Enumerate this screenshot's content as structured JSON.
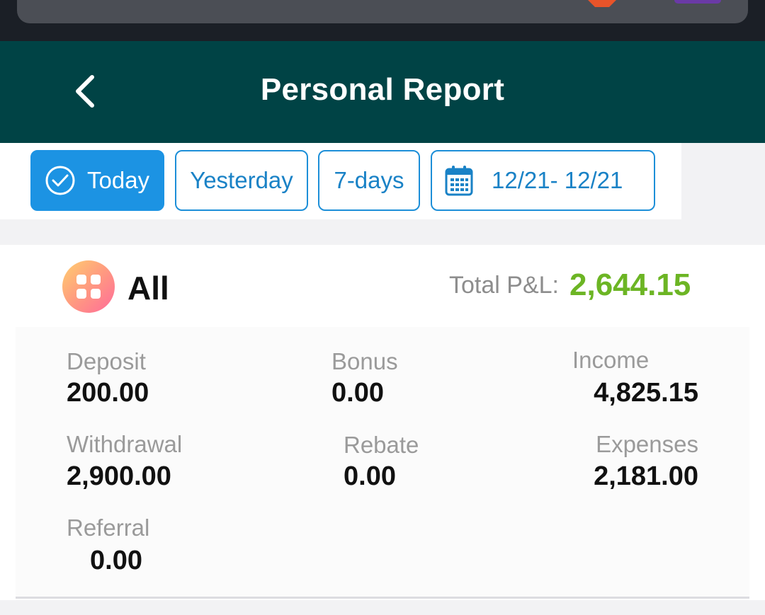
{
  "header": {
    "title": "Personal Report"
  },
  "filters": {
    "today": "Today",
    "yesterday": "Yesterday",
    "seven_days": "7-days",
    "date_range": "12/21- 12/21",
    "active": "Today"
  },
  "summary": {
    "category": "All",
    "total_pl_label": "Total P&L:",
    "total_pl_value": "2,644.15",
    "total_pl_color": "#6cb524"
  },
  "stats": {
    "deposit": {
      "label": "Deposit",
      "value": "200.00"
    },
    "bonus": {
      "label": "Bonus",
      "value": "0.00"
    },
    "income": {
      "label": "Income",
      "value": "4,825.15"
    },
    "withdrawal": {
      "label": "Withdrawal",
      "value": "2,900.00"
    },
    "rebate": {
      "label": "Rebate",
      "value": "0.00"
    },
    "expenses": {
      "label": "Expenses",
      "value": "2,181.00"
    },
    "referral": {
      "label": "Referral",
      "value": "0.00"
    }
  },
  "colors": {
    "header_bg": "#004345",
    "accent": "#1c93e3"
  },
  "icons": {
    "back": "chevron-left-icon",
    "check": "check-circle-icon",
    "calendar": "calendar-icon",
    "all": "grid-apps-icon"
  }
}
